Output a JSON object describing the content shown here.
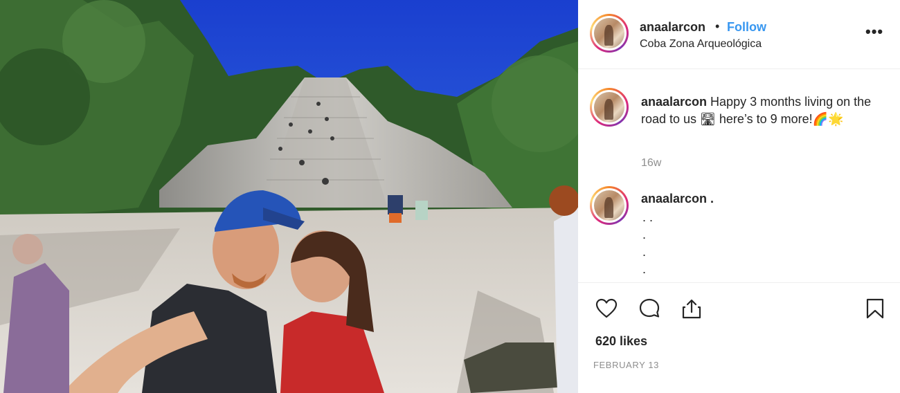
{
  "post": {
    "photo_description_icon": "photo-image",
    "colors": {
      "sky": "#1f4fd6",
      "follow": "#3897f0",
      "muted": "#8e8e8e",
      "text": "#262626"
    }
  },
  "header": {
    "username": "anaalarcon",
    "separator": "•",
    "follow_label": "Follow",
    "location": "Coba Zona Arqueológica",
    "more_label": "•••"
  },
  "caption": {
    "username": "anaalarcon",
    "text": " Happy 3 months living on the road to us 🛣 here’s to 9 more!🌈🌟",
    "time": "16w"
  },
  "comment": {
    "username": "anaalarcon",
    "text": " .",
    "dots": [
      ". .",
      ".",
      ".",
      "."
    ]
  },
  "actions": {
    "icons": [
      "heart-icon",
      "comment-icon",
      "share-icon",
      "bookmark-icon"
    ],
    "likes": "620 likes",
    "date": "FEBRUARY 13"
  }
}
